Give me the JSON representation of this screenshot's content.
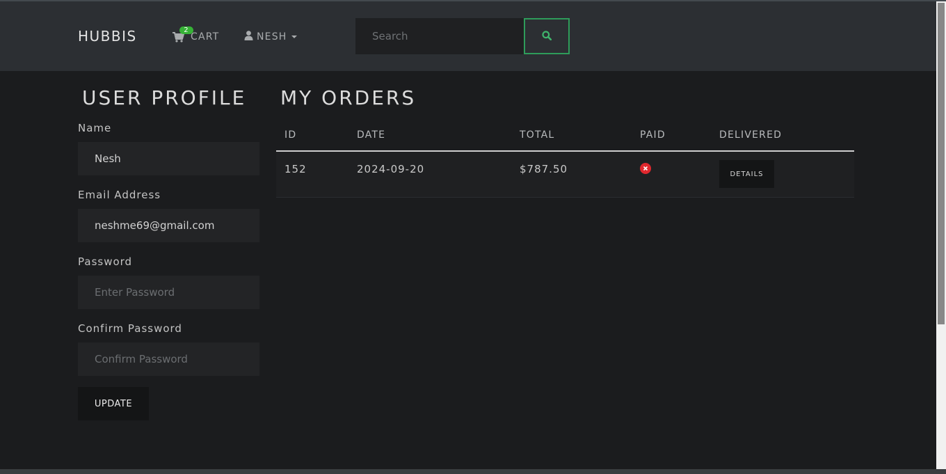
{
  "navbar": {
    "brand": "HUBBIS",
    "cart_label": "CART",
    "cart_count": "2",
    "user_label": "NESH",
    "search_placeholder": "Search",
    "cart_icon": "shopping-cart-icon",
    "user_icon": "user-icon",
    "search_icon": "search-icon"
  },
  "profile": {
    "title": "USER PROFILE",
    "name_label": "Name",
    "name_value": "Nesh",
    "email_label": "Email Address",
    "email_value": "neshme69@gmail.com",
    "password_label": "Password",
    "password_placeholder": "Enter Password",
    "confirm_label": "Confirm Password",
    "confirm_placeholder": "Confirm Password",
    "update_label": "UPDATE"
  },
  "orders": {
    "title": "MY ORDERS",
    "columns": [
      "ID",
      "DATE",
      "TOTAL",
      "PAID",
      "DELIVERED"
    ],
    "rows": [
      {
        "id": "152",
        "date": "2024-09-20",
        "total": "$787.50",
        "paid": false,
        "paid_icon": "x-circle-icon",
        "action_label": "DETAILS"
      }
    ]
  },
  "colors": {
    "background": "#1b1c1e",
    "navbar": "#2c2f33",
    "accent_green": "#2e9c5a",
    "badge_green": "#36b236",
    "unpaid_red": "#e0282e"
  }
}
